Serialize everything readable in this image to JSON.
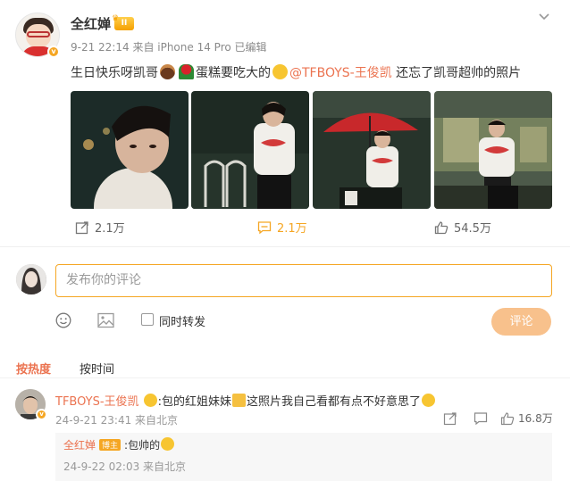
{
  "post": {
    "author": "全红婵",
    "member_level": "II",
    "meta": "9-21 22:14 来自 iPhone 14 Pro 已编辑",
    "text_a": "生日快乐呀凯哥",
    "text_b": "蛋糕要吃大的",
    "mention": "@TFBOYS-王俊凯",
    "text_c": " 还忘了凯哥超帅的照片",
    "emojis": [
      "cake-emoji",
      "rose-emoji",
      "laugh-emoji"
    ],
    "photo_count": 4
  },
  "actions": {
    "repost": "2.1万",
    "comment": "2.1万",
    "like": "54.5万"
  },
  "comment_box": {
    "placeholder": "发布你的评论",
    "repost_label": "同时转发",
    "submit": "评论"
  },
  "sort": {
    "hot": "按热度",
    "time": "按时间"
  },
  "comments": [
    {
      "name": "TFBOYS-王俊凯",
      "text_a": ":包的红姐妹妹",
      "text_b": "这照片我自己看都有点不好意思了",
      "meta": "24-9-21 23:41 来自北京",
      "likes": "16.8万"
    }
  ],
  "reply": {
    "name": "全红婵",
    "badge": "博主",
    "text": ":包帅的",
    "meta": "24-9-22 02:03 来自北京"
  },
  "colors": {
    "accent": "#eb7350",
    "active_orange": "#f5a623",
    "button_disabled": "#f8c18c"
  }
}
